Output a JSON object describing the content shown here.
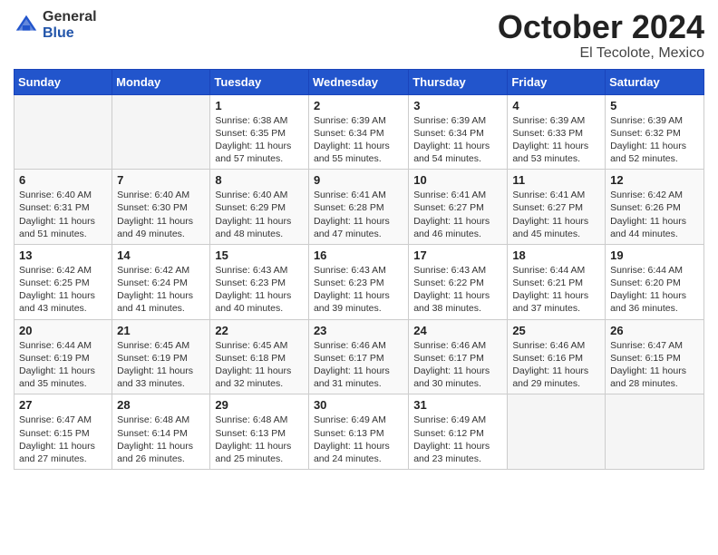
{
  "logo": {
    "general": "General",
    "blue": "Blue"
  },
  "title": {
    "month": "October 2024",
    "location": "El Tecolote, Mexico"
  },
  "weekdays": [
    "Sunday",
    "Monday",
    "Tuesday",
    "Wednesday",
    "Thursday",
    "Friday",
    "Saturday"
  ],
  "weeks": [
    [
      {
        "day": "",
        "info": ""
      },
      {
        "day": "",
        "info": ""
      },
      {
        "day": "1",
        "info": "Sunrise: 6:38 AM\nSunset: 6:35 PM\nDaylight: 11 hours and 57 minutes."
      },
      {
        "day": "2",
        "info": "Sunrise: 6:39 AM\nSunset: 6:34 PM\nDaylight: 11 hours and 55 minutes."
      },
      {
        "day": "3",
        "info": "Sunrise: 6:39 AM\nSunset: 6:34 PM\nDaylight: 11 hours and 54 minutes."
      },
      {
        "day": "4",
        "info": "Sunrise: 6:39 AM\nSunset: 6:33 PM\nDaylight: 11 hours and 53 minutes."
      },
      {
        "day": "5",
        "info": "Sunrise: 6:39 AM\nSunset: 6:32 PM\nDaylight: 11 hours and 52 minutes."
      }
    ],
    [
      {
        "day": "6",
        "info": "Sunrise: 6:40 AM\nSunset: 6:31 PM\nDaylight: 11 hours and 51 minutes."
      },
      {
        "day": "7",
        "info": "Sunrise: 6:40 AM\nSunset: 6:30 PM\nDaylight: 11 hours and 49 minutes."
      },
      {
        "day": "8",
        "info": "Sunrise: 6:40 AM\nSunset: 6:29 PM\nDaylight: 11 hours and 48 minutes."
      },
      {
        "day": "9",
        "info": "Sunrise: 6:41 AM\nSunset: 6:28 PM\nDaylight: 11 hours and 47 minutes."
      },
      {
        "day": "10",
        "info": "Sunrise: 6:41 AM\nSunset: 6:27 PM\nDaylight: 11 hours and 46 minutes."
      },
      {
        "day": "11",
        "info": "Sunrise: 6:41 AM\nSunset: 6:27 PM\nDaylight: 11 hours and 45 minutes."
      },
      {
        "day": "12",
        "info": "Sunrise: 6:42 AM\nSunset: 6:26 PM\nDaylight: 11 hours and 44 minutes."
      }
    ],
    [
      {
        "day": "13",
        "info": "Sunrise: 6:42 AM\nSunset: 6:25 PM\nDaylight: 11 hours and 43 minutes."
      },
      {
        "day": "14",
        "info": "Sunrise: 6:42 AM\nSunset: 6:24 PM\nDaylight: 11 hours and 41 minutes."
      },
      {
        "day": "15",
        "info": "Sunrise: 6:43 AM\nSunset: 6:23 PM\nDaylight: 11 hours and 40 minutes."
      },
      {
        "day": "16",
        "info": "Sunrise: 6:43 AM\nSunset: 6:23 PM\nDaylight: 11 hours and 39 minutes."
      },
      {
        "day": "17",
        "info": "Sunrise: 6:43 AM\nSunset: 6:22 PM\nDaylight: 11 hours and 38 minutes."
      },
      {
        "day": "18",
        "info": "Sunrise: 6:44 AM\nSunset: 6:21 PM\nDaylight: 11 hours and 37 minutes."
      },
      {
        "day": "19",
        "info": "Sunrise: 6:44 AM\nSunset: 6:20 PM\nDaylight: 11 hours and 36 minutes."
      }
    ],
    [
      {
        "day": "20",
        "info": "Sunrise: 6:44 AM\nSunset: 6:19 PM\nDaylight: 11 hours and 35 minutes."
      },
      {
        "day": "21",
        "info": "Sunrise: 6:45 AM\nSunset: 6:19 PM\nDaylight: 11 hours and 33 minutes."
      },
      {
        "day": "22",
        "info": "Sunrise: 6:45 AM\nSunset: 6:18 PM\nDaylight: 11 hours and 32 minutes."
      },
      {
        "day": "23",
        "info": "Sunrise: 6:46 AM\nSunset: 6:17 PM\nDaylight: 11 hours and 31 minutes."
      },
      {
        "day": "24",
        "info": "Sunrise: 6:46 AM\nSunset: 6:17 PM\nDaylight: 11 hours and 30 minutes."
      },
      {
        "day": "25",
        "info": "Sunrise: 6:46 AM\nSunset: 6:16 PM\nDaylight: 11 hours and 29 minutes."
      },
      {
        "day": "26",
        "info": "Sunrise: 6:47 AM\nSunset: 6:15 PM\nDaylight: 11 hours and 28 minutes."
      }
    ],
    [
      {
        "day": "27",
        "info": "Sunrise: 6:47 AM\nSunset: 6:15 PM\nDaylight: 11 hours and 27 minutes."
      },
      {
        "day": "28",
        "info": "Sunrise: 6:48 AM\nSunset: 6:14 PM\nDaylight: 11 hours and 26 minutes."
      },
      {
        "day": "29",
        "info": "Sunrise: 6:48 AM\nSunset: 6:13 PM\nDaylight: 11 hours and 25 minutes."
      },
      {
        "day": "30",
        "info": "Sunrise: 6:49 AM\nSunset: 6:13 PM\nDaylight: 11 hours and 24 minutes."
      },
      {
        "day": "31",
        "info": "Sunrise: 6:49 AM\nSunset: 6:12 PM\nDaylight: 11 hours and 23 minutes."
      },
      {
        "day": "",
        "info": ""
      },
      {
        "day": "",
        "info": ""
      }
    ]
  ]
}
